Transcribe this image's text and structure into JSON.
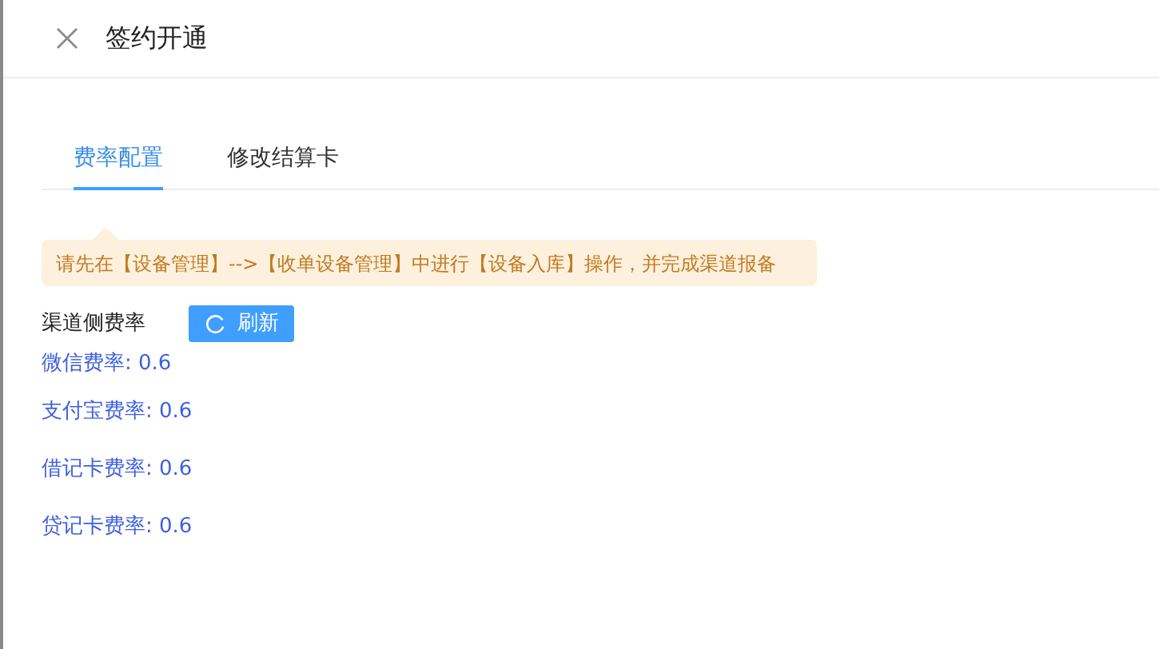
{
  "dialog": {
    "title": "签约开通"
  },
  "tabs": [
    {
      "label": "费率配置",
      "selected": true
    },
    {
      "label": "修改结算卡",
      "selected": false
    }
  ],
  "notice": "请先在【设备管理】-->【收单设备管理】中进行【设备入库】操作，并完成渠道报备",
  "channel_rates": {
    "label": "渠道侧费率",
    "refresh_button": "刷新"
  },
  "rates": [
    "微信费率: 0.6",
    "支付宝费率: 0.6",
    "借记卡费率: 0.6",
    "贷记卡费率: 0.6"
  ]
}
